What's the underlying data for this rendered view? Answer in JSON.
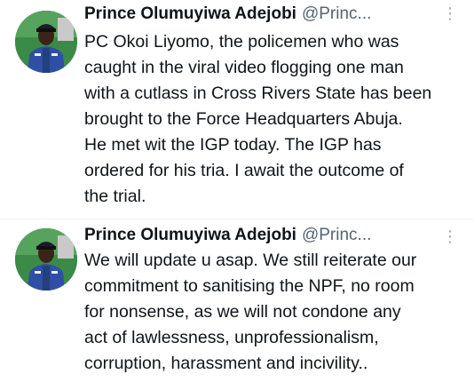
{
  "tweets": [
    {
      "display_name": "Prince Olumuyiwa Adejobi",
      "handle": "@Princ...",
      "more_icon": "more-dots-icon",
      "text_lines": [
        "PC Okoi Liyomo, the policemen who was",
        "caught in the viral video flogging one man",
        "with a cutlass in Cross Rivers State has been",
        "brought to the Force Headquarters Abuja.",
        "He met wit the IGP today. The IGP has",
        "ordered for his tria. I await the outcome of",
        "the trial."
      ]
    },
    {
      "display_name": "Prince Olumuyiwa Adejobi",
      "handle": "@Princ...",
      "more_icon": "more-dots-icon",
      "text_lines": [
        "We will update u asap. We still reiterate our",
        "commitment to sanitising the NPF, no room",
        "for nonsense, as we will not condone any",
        "act of lawlessness, unprofessionalism,",
        "corruption, harassment and incivility.."
      ]
    }
  ],
  "colors": {
    "text": "#0f1419",
    "secondary": "#536471",
    "avatar_bg": "#2f7a3c",
    "uniform": "#2e4fa3"
  }
}
